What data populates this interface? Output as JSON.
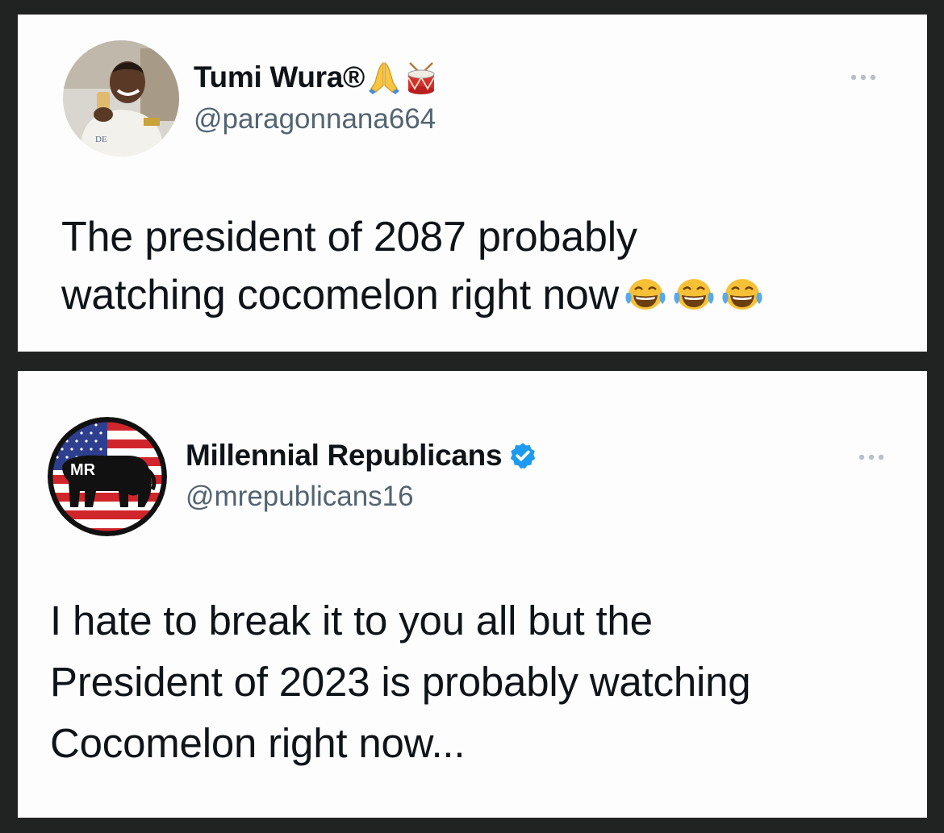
{
  "tweets": [
    {
      "display_name": "Tumi Wura®",
      "handle": "@paragonnana664",
      "name_emojis": [
        "folded-hands-icon",
        "drum-icon"
      ],
      "text_lines": [
        "The president of 2087 probably",
        "watching cocomelon right now"
      ],
      "trailing_emojis": [
        "face-with-tears-of-joy-icon",
        "face-with-tears-of-joy-icon",
        "face-with-tears-of-joy-icon"
      ],
      "avatar": "profile-photo"
    },
    {
      "display_name": "Millennial Republicans",
      "handle": "@mrepublicans16",
      "verified": true,
      "avatar_logo_text": "MR",
      "text_lines": [
        "I hate to break it to you all but the",
        "President of 2023 is probably watching",
        "Cocomelon right now..."
      ]
    }
  ],
  "colors": {
    "background": "#212222",
    "card": "#fdfdfd",
    "name": "#0f1419",
    "handle": "#536471",
    "verified": "#1d9bf0"
  }
}
